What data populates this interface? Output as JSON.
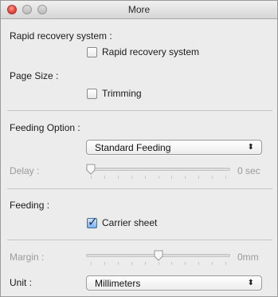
{
  "window": {
    "title": "More"
  },
  "rapid": {
    "heading": "Rapid recovery system :",
    "checkbox_label": "Rapid recovery system",
    "checked": false
  },
  "page_size": {
    "heading": "Page Size :",
    "checkbox_label": "Trimming",
    "checked": false
  },
  "feeding_option": {
    "heading": "Feeding Option :",
    "selected": "Standard Feeding"
  },
  "delay": {
    "label": "Delay :",
    "value_text": "0 sec",
    "level": 0.0,
    "enabled": false
  },
  "feeding": {
    "heading": "Feeding :",
    "checkbox_label": "Carrier sheet",
    "checked": true
  },
  "margin": {
    "label": "Margin :",
    "value_text": "0mm",
    "level": 0.5,
    "enabled": false
  },
  "unit": {
    "label": "Unit :",
    "selected": "Millimeters"
  },
  "colors": {
    "accent": "#3a6fb0",
    "disabled_text": "#9a9a9a"
  }
}
